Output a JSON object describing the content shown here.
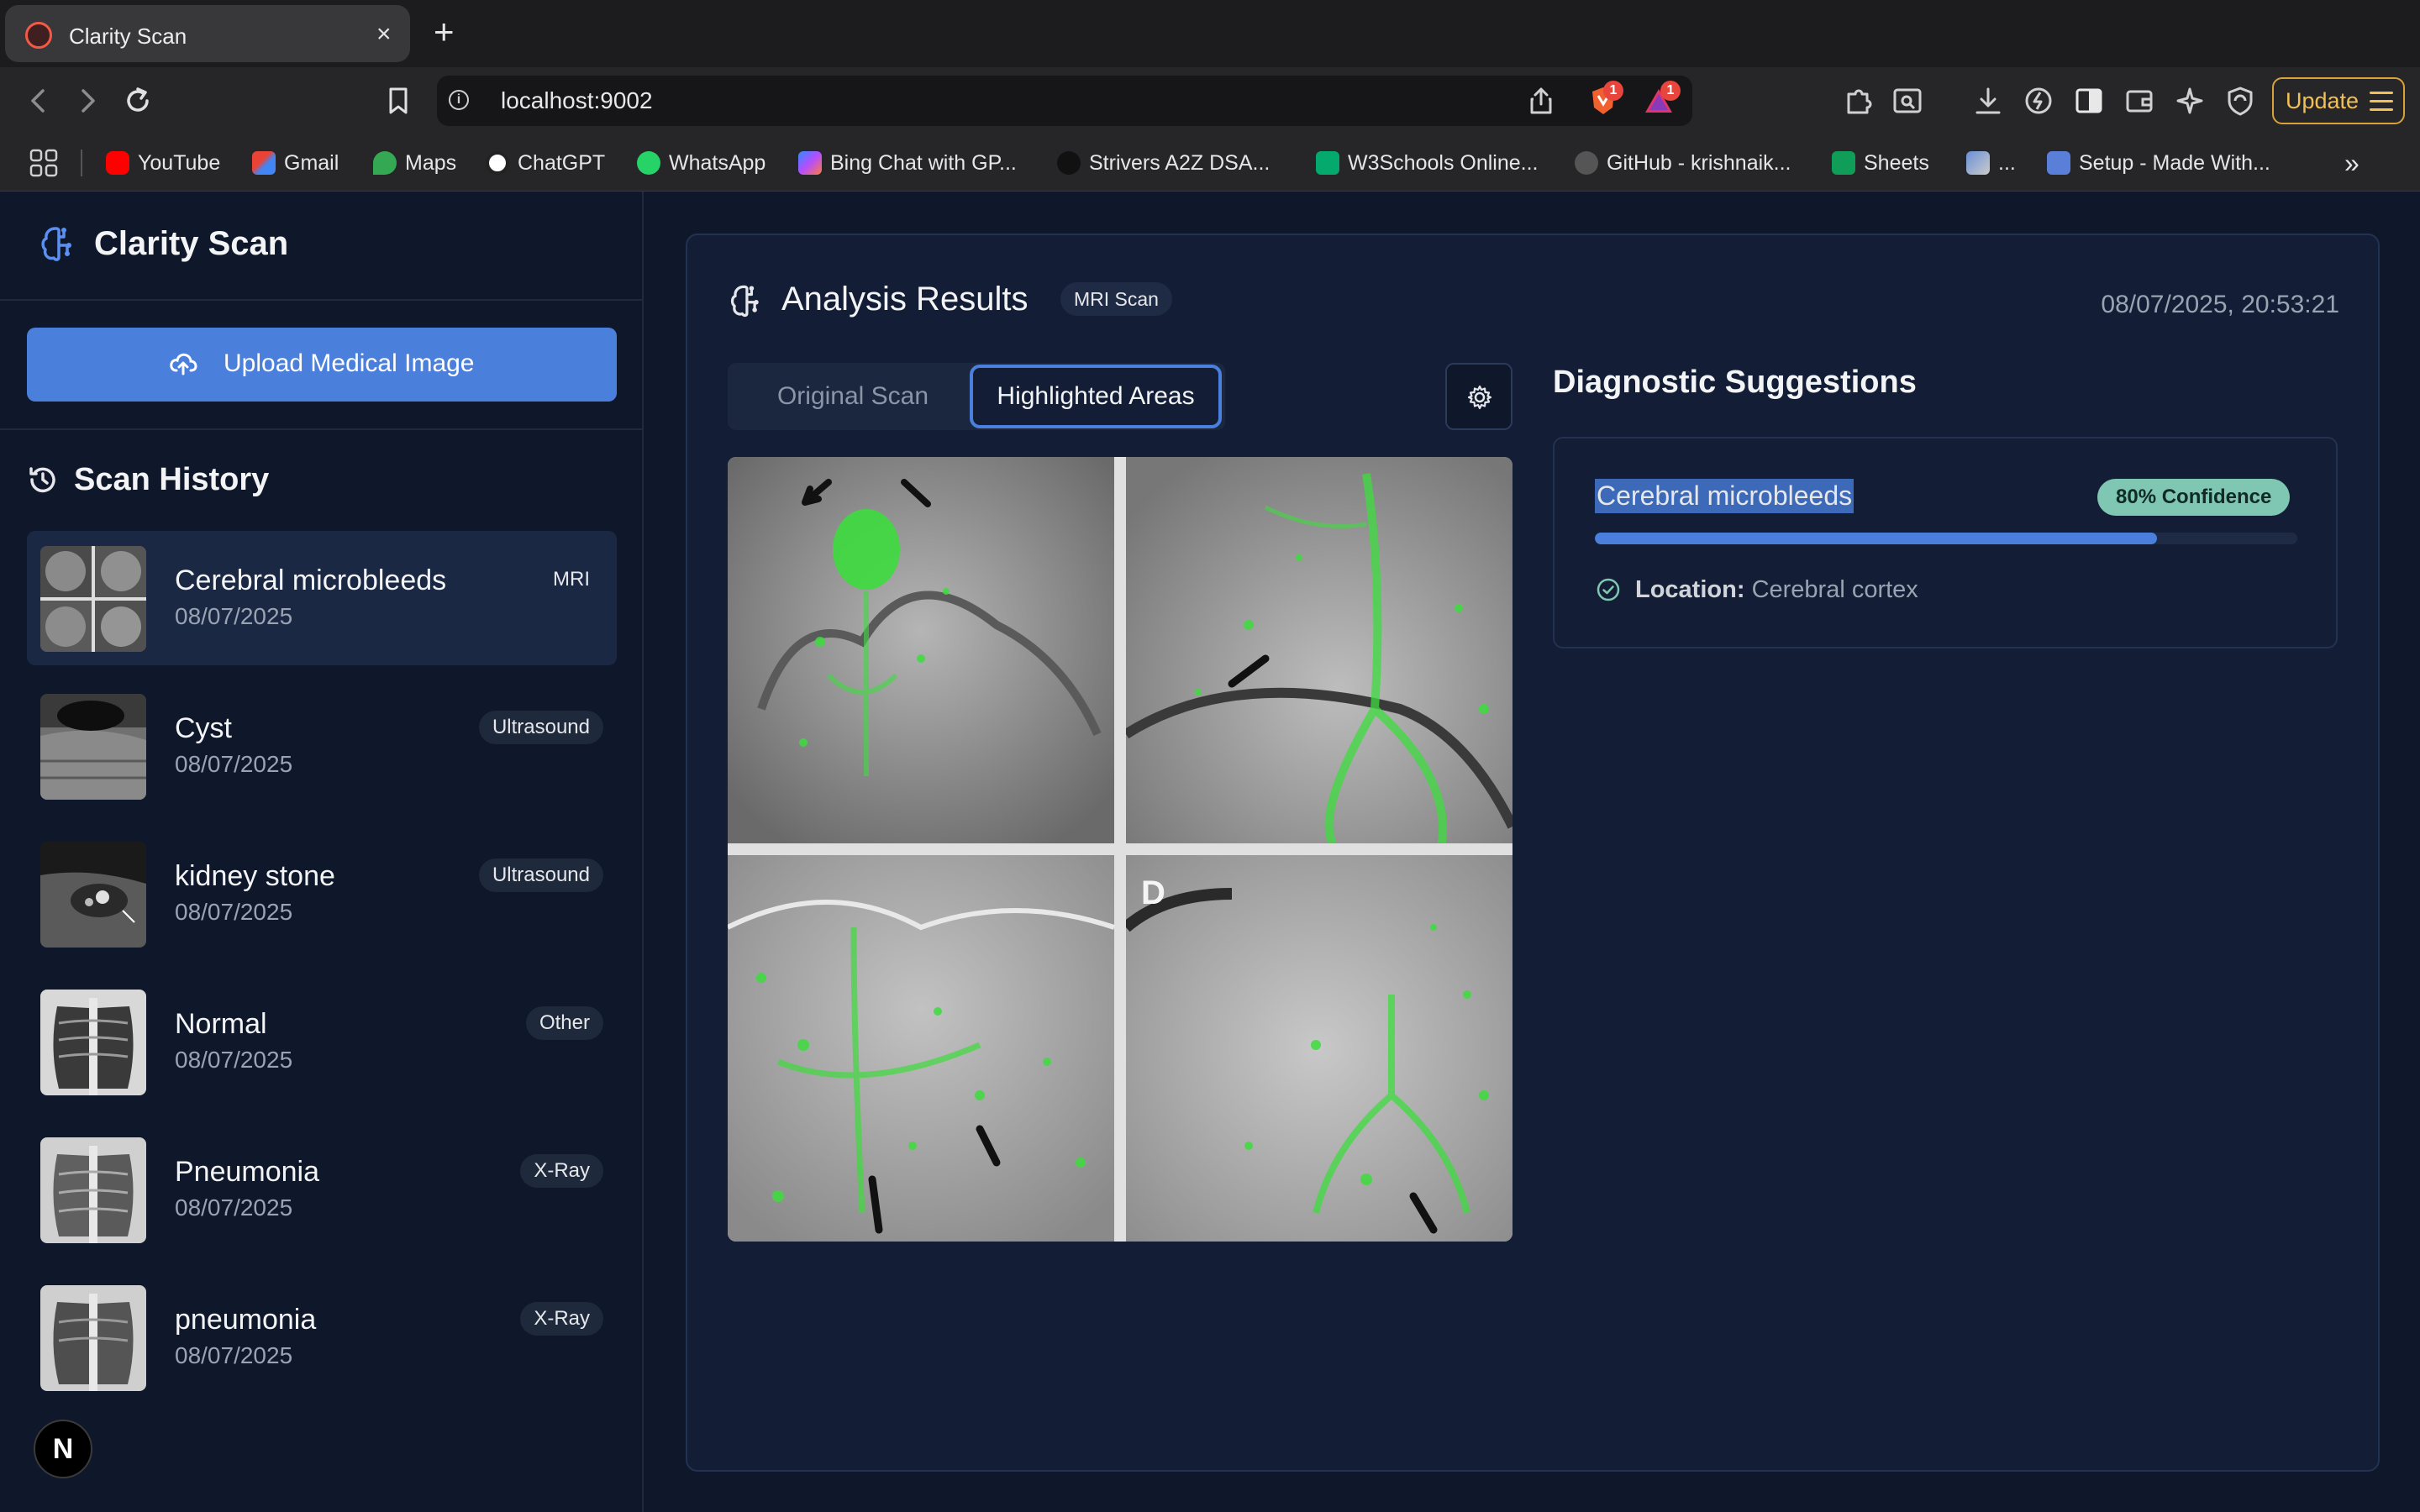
{
  "browser": {
    "tab_title": "Clarity Scan",
    "tab_close": "×",
    "new_tab": "+",
    "url": "localhost:9002",
    "update_label": "Update",
    "ext_badges": [
      "1",
      "1"
    ],
    "bookmarks": [
      "YouTube",
      "Gmail",
      "Maps",
      "ChatGPT",
      "WhatsApp",
      "Bing Chat with GP...",
      "Strivers A2Z DSA...",
      "W3Schools Online...",
      "GitHub - krishnaik...",
      "Sheets",
      "...",
      "Setup - Made With..."
    ],
    "more_bookmarks": "»"
  },
  "sidebar": {
    "brand": "Clarity Scan",
    "upload_label": "Upload Medical Image",
    "history_title": "Scan History",
    "items": [
      {
        "name": "Cerebral microbleeds",
        "date": "08/07/2025",
        "tag": "MRI"
      },
      {
        "name": "Cyst",
        "date": "08/07/2025",
        "tag": "Ultrasound"
      },
      {
        "name": "kidney stone",
        "date": "08/07/2025",
        "tag": "Ultrasound"
      },
      {
        "name": "Normal",
        "date": "08/07/2025",
        "tag": "Other"
      },
      {
        "name": "Pneumonia",
        "date": "08/07/2025",
        "tag": "X-Ray"
      },
      {
        "name": "pneumonia",
        "date": "08/07/2025",
        "tag": "X-Ray"
      }
    ],
    "avatar_letter": "N"
  },
  "main": {
    "title": "Analysis Results",
    "scan_type": "MRI Scan",
    "timestamp": "08/07/2025, 20:53:21",
    "tabs": {
      "original": "Original Scan",
      "highlighted": "Highlighted Areas"
    },
    "active_tab": "highlighted",
    "image_label": "D"
  },
  "diagnostics": {
    "title": "Diagnostic Suggestions",
    "items": [
      {
        "name": "Cerebral microbleeds",
        "confidence_label": "80% Confidence",
        "confidence": 0.8,
        "location_label": "Location:",
        "location": "Cerebral cortex"
      }
    ]
  },
  "colors": {
    "accent": "#4a7fdc",
    "confidence_badge": "#7fc7b2",
    "background": "#0f172a",
    "highlight": "#3ddc3d"
  }
}
